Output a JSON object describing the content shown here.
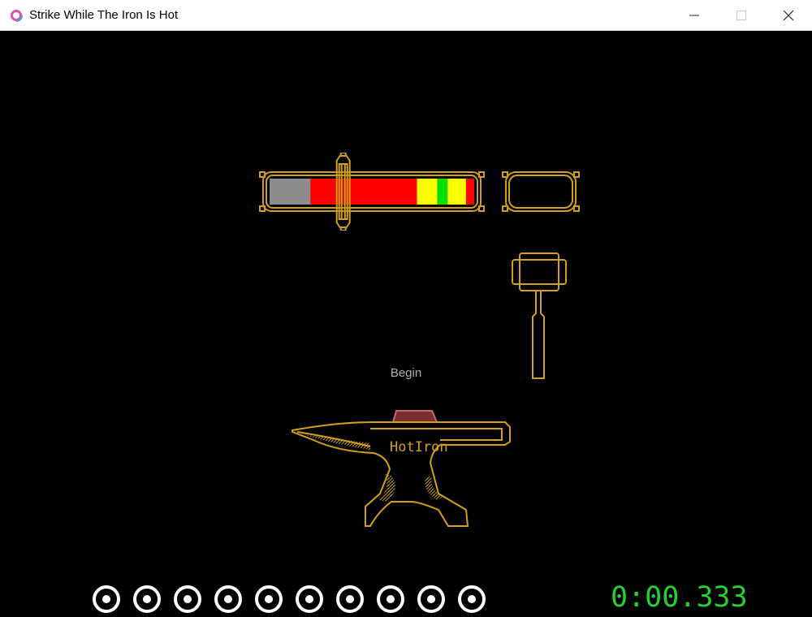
{
  "window": {
    "title": "Strike While The Iron Is Hot",
    "controls": [
      "minimize",
      "maximize",
      "close"
    ]
  },
  "game": {
    "status_text": "Begin",
    "timer": "0:00.333",
    "anvil_label": "HotIron",
    "heat_meter": {
      "marker_position": 0.36,
      "segments": [
        {
          "zone": "cold",
          "color": "#8c8c8c",
          "fraction": 0.2
        },
        {
          "zone": "hot",
          "color": "#ff0000",
          "fraction": 0.52
        },
        {
          "zone": "warm",
          "color": "#ffff00",
          "fraction": 0.1
        },
        {
          "zone": "perfect",
          "color": "#00e000",
          "fraction": 0.05
        },
        {
          "zone": "warm",
          "color": "#ffff00",
          "fraction": 0.09
        },
        {
          "zone": "hot",
          "color": "#ff0000",
          "fraction": 0.04
        }
      ]
    },
    "strikes_remaining": 10,
    "strikes_total": 10,
    "colors": {
      "outline": "#d4a017",
      "timer": "#27d12d",
      "hot_iron": "#c46a6a",
      "background": "#000000"
    }
  }
}
